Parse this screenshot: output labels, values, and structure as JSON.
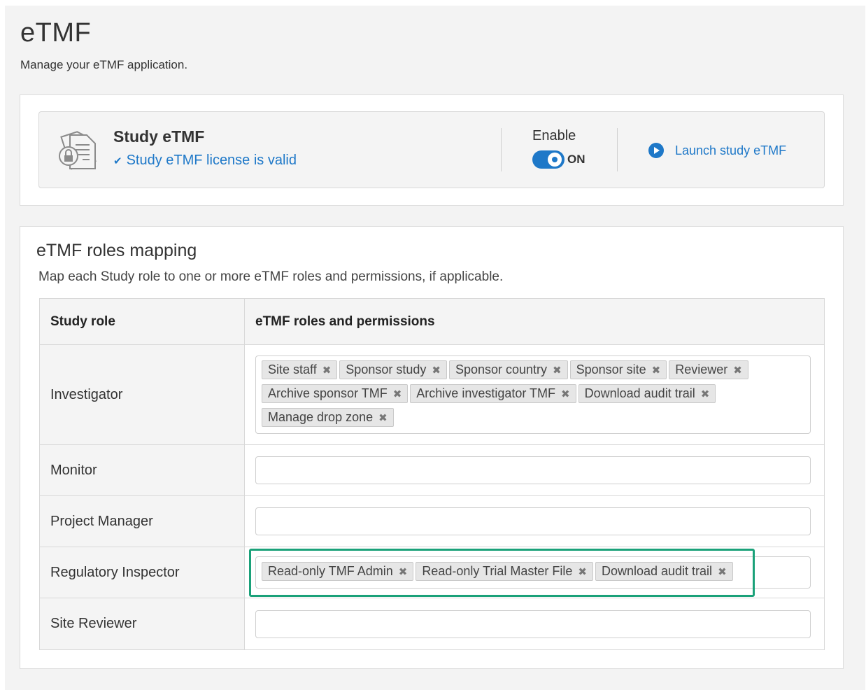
{
  "page": {
    "title": "eTMF",
    "subtitle": "Manage your eTMF application."
  },
  "study_card": {
    "title": "Study eTMF",
    "license_icon": "check-icon",
    "license_status": "Study eTMF license is valid",
    "enable_label": "Enable",
    "toggle_state": "ON",
    "launch_label": "Launch study eTMF"
  },
  "mapping": {
    "title": "eTMF roles mapping",
    "description": "Map each Study role to one or more eTMF roles and permissions, if applicable.",
    "columns": [
      "Study role",
      "eTMF roles and permissions"
    ],
    "rows": [
      {
        "role": "Investigator",
        "tags": [
          "Site staff",
          "Sponsor study",
          "Sponsor country",
          "Sponsor site",
          "Reviewer",
          "Archive sponsor TMF",
          "Archive investigator TMF",
          "Download audit trail",
          "Manage drop zone"
        ]
      },
      {
        "role": "Monitor",
        "tags": []
      },
      {
        "role": "Project Manager",
        "tags": []
      },
      {
        "role": "Regulatory Inspector",
        "tags": [
          "Read-only TMF Admin",
          "Read-only Trial Master File",
          "Download audit trail"
        ]
      },
      {
        "role": "Site Reviewer",
        "tags": []
      }
    ]
  },
  "colors": {
    "accent": "#1e78c8",
    "highlight": "#1aa179"
  }
}
